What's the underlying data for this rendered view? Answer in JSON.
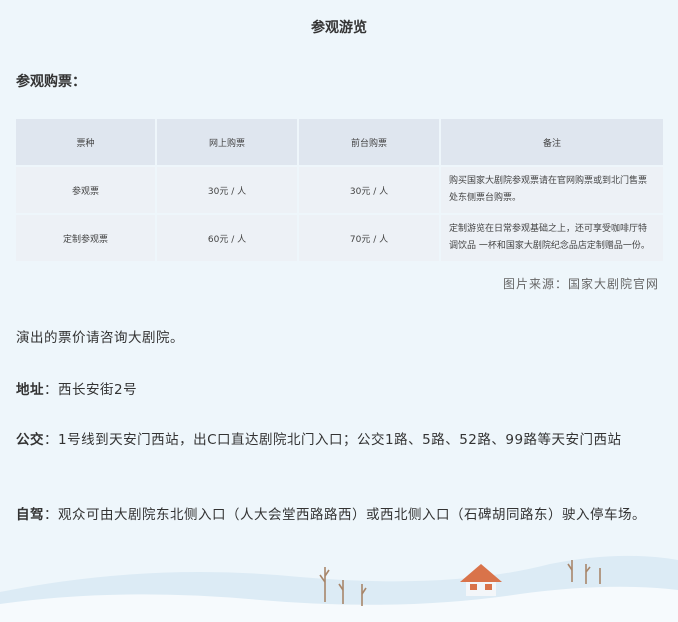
{
  "title": "参观游览",
  "tickets_heading": "参观购票：",
  "table": {
    "headers": [
      "票种",
      "网上购票",
      "前台购票",
      "备注"
    ],
    "rows": [
      {
        "type": "参观票",
        "online": "30元 / 人",
        "counter": "30元 / 人",
        "note": "购买国家大剧院参观票请在官网购票或到北门售票处东侧票台购票。"
      },
      {
        "type": "定制参观票",
        "online": "60元 / 人",
        "counter": "70元 / 人",
        "note": "定制游览在日常参观基础之上，还可享受咖啡厅特调饮品 一杯和国家大剧院纪念品店定制赠品一份。"
      }
    ]
  },
  "image_credit": "图片来源：国家大剧院官网",
  "performance_note": "演出的票价请咨询大剧院。",
  "address": {
    "label": "地址",
    "sep": "：",
    "text": "西长安街2号"
  },
  "bus": {
    "label": "公交",
    "sep": "：",
    "text": "1号线到天安门西站，出C口直达剧院北门入口；公交1路、5路、52路、99路等天安门西站"
  },
  "drive": {
    "label": "自驾",
    "sep": "：",
    "text": "观众可由大剧院东北侧入口（人大会堂西路路西）或西北侧入口（石碑胡同路东）驶入停车场。"
  },
  "colors": {
    "page_bg": "#eef6fb",
    "header_cell_bg": "#dfe6ef",
    "body_cell_bg": "#edf1f6",
    "house_roof": "#d9734a"
  }
}
